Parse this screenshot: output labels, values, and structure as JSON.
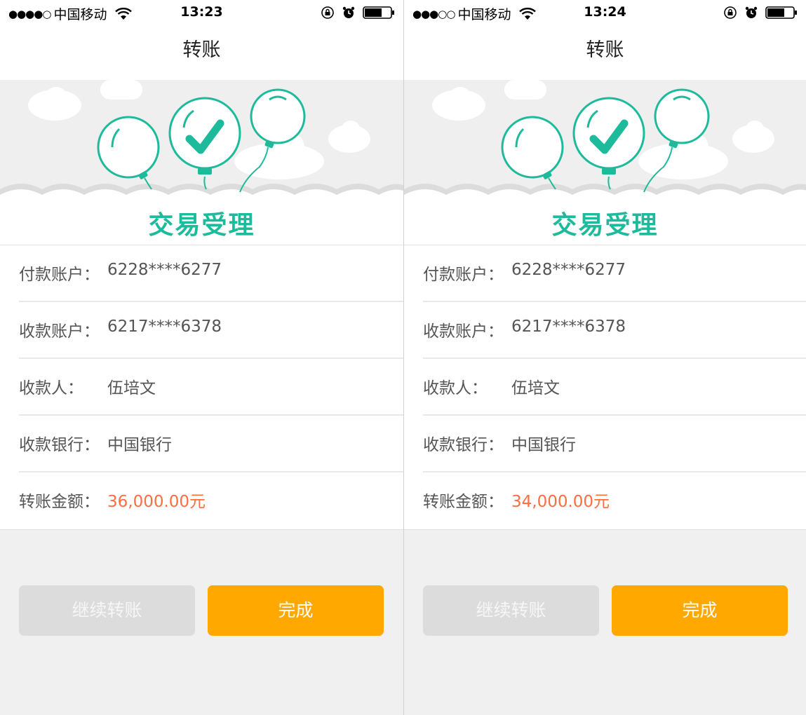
{
  "screens": [
    {
      "status": {
        "signal": "●●●●○",
        "carrier": "中国移动",
        "time": "13:23"
      },
      "nav": {
        "title": "转账"
      },
      "banner": {
        "title": "交易受理"
      },
      "rows": [
        {
          "label": "付款账户：",
          "value": "6228****6277"
        },
        {
          "label": "收款账户：",
          "value": "6217****6378"
        },
        {
          "label": "收款人：",
          "value": "伍培文"
        },
        {
          "label": "收款银行：",
          "value": "中国银行"
        },
        {
          "label": "转账金额：",
          "value": "36,000.00元"
        }
      ],
      "buttons": {
        "continue": "继续转账",
        "done": "完成"
      }
    },
    {
      "status": {
        "signal": "●●●○○",
        "carrier": "中国移动",
        "time": "13:24"
      },
      "nav": {
        "title": "转账"
      },
      "banner": {
        "title": "交易受理"
      },
      "rows": [
        {
          "label": "付款账户：",
          "value": "6228****6277"
        },
        {
          "label": "收款账户：",
          "value": "6217****6378"
        },
        {
          "label": "收款人：",
          "value": "伍培文"
        },
        {
          "label": "收款银行：",
          "value": "中国银行"
        },
        {
          "label": "转账金额：",
          "value": "34,000.00元"
        }
      ],
      "buttons": {
        "continue": "继续转账",
        "done": "完成"
      }
    }
  ],
  "colors": {
    "accent_green": "#1dba9b",
    "amount_orange": "#ff6d42",
    "done_button": "#ffa800",
    "continue_button": "#dcdcdc"
  },
  "icons": [
    "wifi-icon",
    "rotation-lock-icon",
    "alarm-icon",
    "battery-icon",
    "balloon-icon",
    "checkmark-icon",
    "cloud-icon"
  ]
}
